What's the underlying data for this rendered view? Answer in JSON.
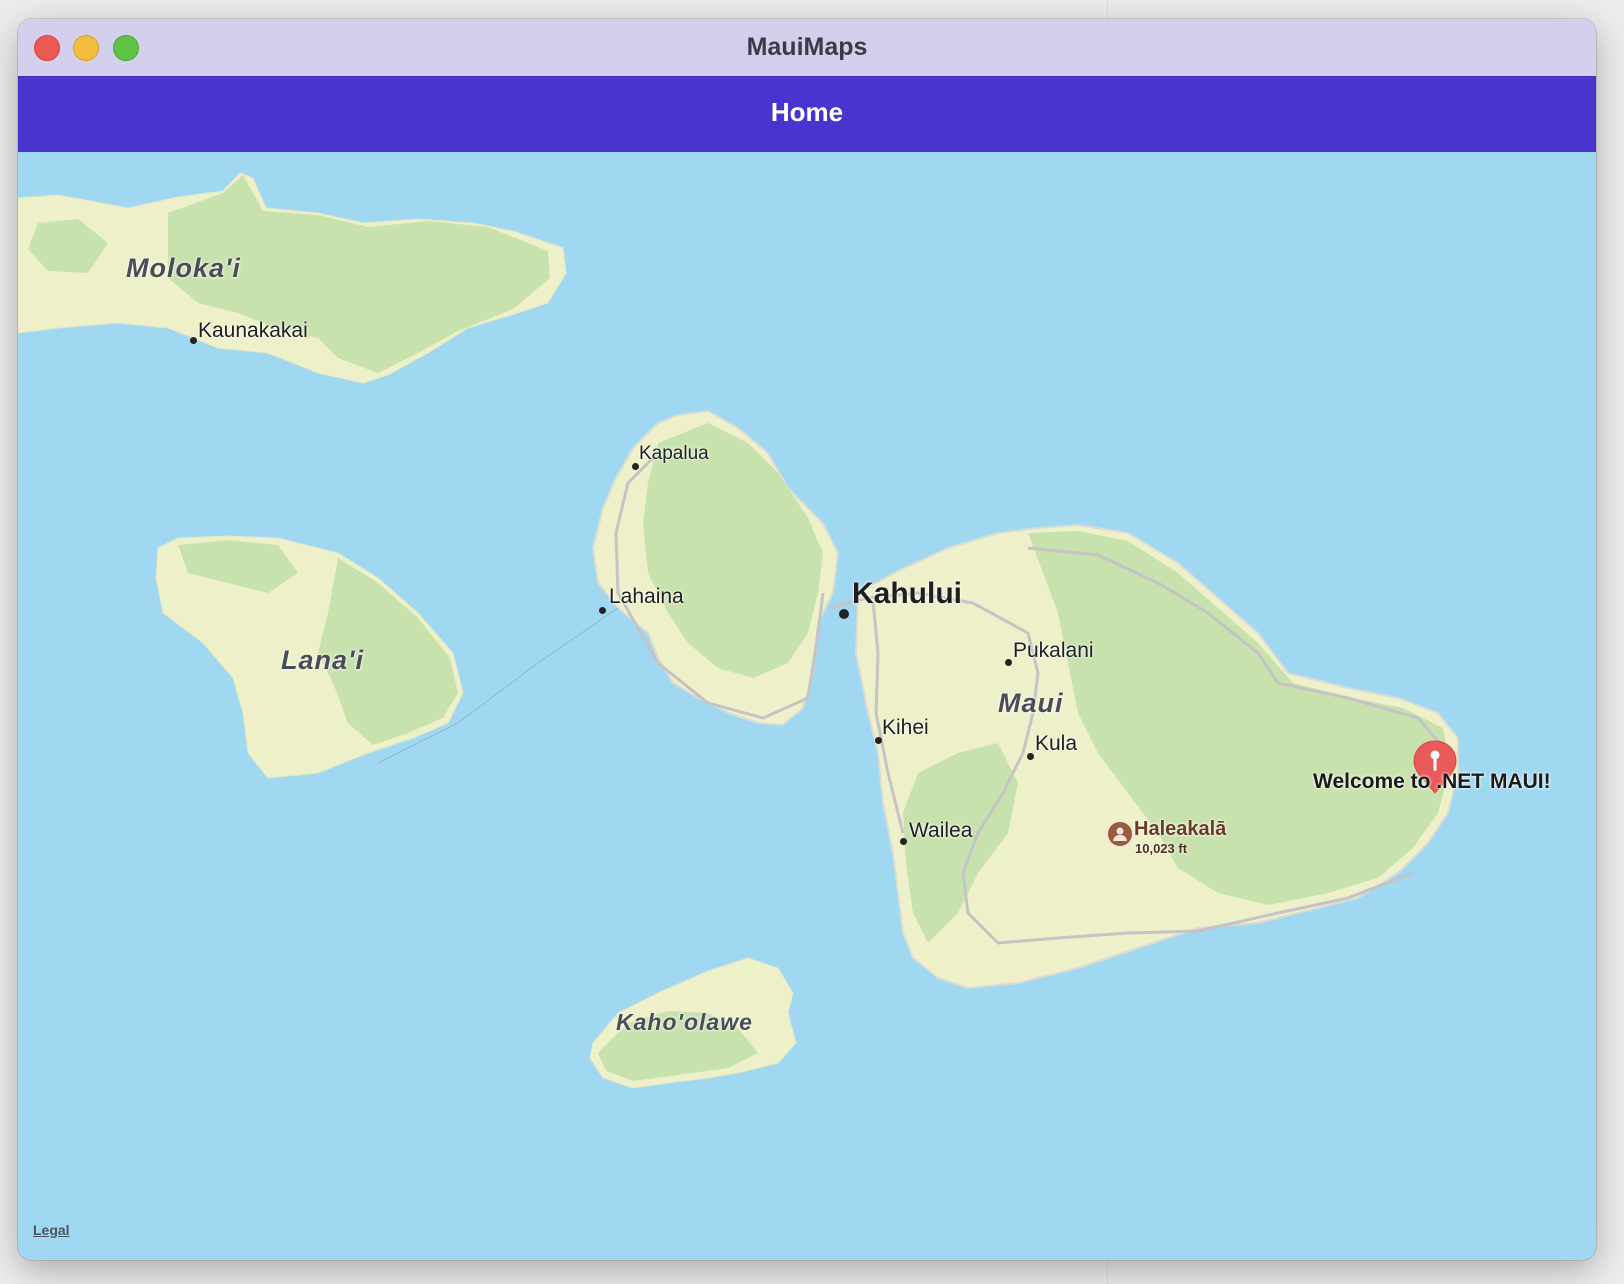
{
  "window": {
    "title": "MauiMaps"
  },
  "navbar": {
    "title": "Home"
  },
  "map": {
    "islands": {
      "molokai": "Moloka'i",
      "lanai": "Lana'i",
      "maui": "Maui",
      "kahoolawe": "Kaho'olawe"
    },
    "places": {
      "kaunakakai": "Kaunakakai",
      "kapalua": "Kapalua",
      "lahaina": "Lahaina",
      "kahului": "Kahului",
      "pukalani": "Pukalani",
      "kihei": "Kihei",
      "kula": "Kula",
      "wailea": "Wailea"
    },
    "peak": {
      "name": "Haleakalā",
      "elevation": "10,023 ft",
      "icon": "mountain-peak-icon"
    },
    "pin": {
      "label": "Welcome to .NET MAUI!",
      "icon": "map-pin-icon",
      "color": "#ea5a5a"
    },
    "legal_link": "Legal"
  },
  "colors": {
    "titlebar": "#d4cfec",
    "navbar": "#4a34cf",
    "water": "#a0d8f2",
    "land": "#eef0c9",
    "vegetation": "#c8e2ad"
  }
}
